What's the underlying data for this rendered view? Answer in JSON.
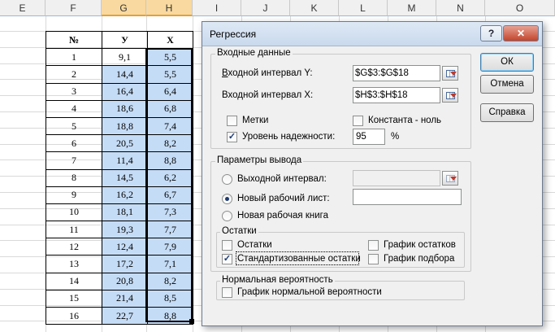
{
  "sheet": {
    "columns": [
      "E",
      "F",
      "G",
      "H",
      "I",
      "J",
      "K",
      "L",
      "M",
      "N",
      "O"
    ],
    "table": {
      "headers": [
        "№",
        "У",
        "Х"
      ],
      "rows": [
        [
          "1",
          "9,1",
          "5,5"
        ],
        [
          "2",
          "14,4",
          "5,5"
        ],
        [
          "3",
          "16,4",
          "6,4"
        ],
        [
          "4",
          "18,6",
          "6,8"
        ],
        [
          "5",
          "18,8",
          "7,4"
        ],
        [
          "6",
          "20,5",
          "8,2"
        ],
        [
          "7",
          "11,4",
          "8,8"
        ],
        [
          "8",
          "14,5",
          "6,2"
        ],
        [
          "9",
          "16,2",
          "6,7"
        ],
        [
          "10",
          "18,1",
          "7,3"
        ],
        [
          "11",
          "19,3",
          "7,7"
        ],
        [
          "12",
          "12,4",
          "7,9"
        ],
        [
          "13",
          "17,2",
          "7,1"
        ],
        [
          "14",
          "20,8",
          "8,2"
        ],
        [
          "15",
          "21,4",
          "8,5"
        ],
        [
          "16",
          "22,7",
          "8,8"
        ]
      ]
    },
    "colors": {
      "selection": "#c5dcf6",
      "header_selected": "#f9d99f"
    }
  },
  "dialog": {
    "title": "Регрессия",
    "help_glyph": "?",
    "close_glyph": "✕",
    "input_group": {
      "label": "Входные данные",
      "y_range_label": "Входной интервал Y:",
      "y_range_value": "$G$3:$G$18",
      "x_range_label": "Входной интервал X:",
      "x_range_value": "$H$3:$H$18",
      "labels_checkbox": "Метки",
      "labels_checked": false,
      "constant_zero_checkbox": "Константа - ноль",
      "constant_zero_checked": false,
      "confidence_checkbox": "Уровень надежности:",
      "confidence_checked": true,
      "confidence_value": "95",
      "percent_sign": "%"
    },
    "output_group": {
      "label": "Параметры вывода",
      "output_range_label": "Выходной интервал:",
      "output_range_value": "",
      "new_sheet_label": "Новый рабочий лист:",
      "new_sheet_value": "",
      "new_workbook_label": "Новая рабочая книга",
      "selected_option": "new_sheet"
    },
    "residuals_group": {
      "label": "Остатки",
      "residuals": "Остатки",
      "residuals_checked": false,
      "standardized": "Стандартизованные остатки",
      "standardized_checked": true,
      "residual_plots": "График остатков",
      "residual_plots_checked": false,
      "line_fit_plots": "График подбора",
      "line_fit_plots_checked": false
    },
    "normal_group": {
      "label": "Нормальная вероятность",
      "normal_plot": "График нормальной вероятности",
      "normal_plot_checked": false
    },
    "buttons": {
      "ok": "ОК",
      "cancel": "Отмена",
      "help": "Справка"
    },
    "check_glyph": "✓"
  }
}
